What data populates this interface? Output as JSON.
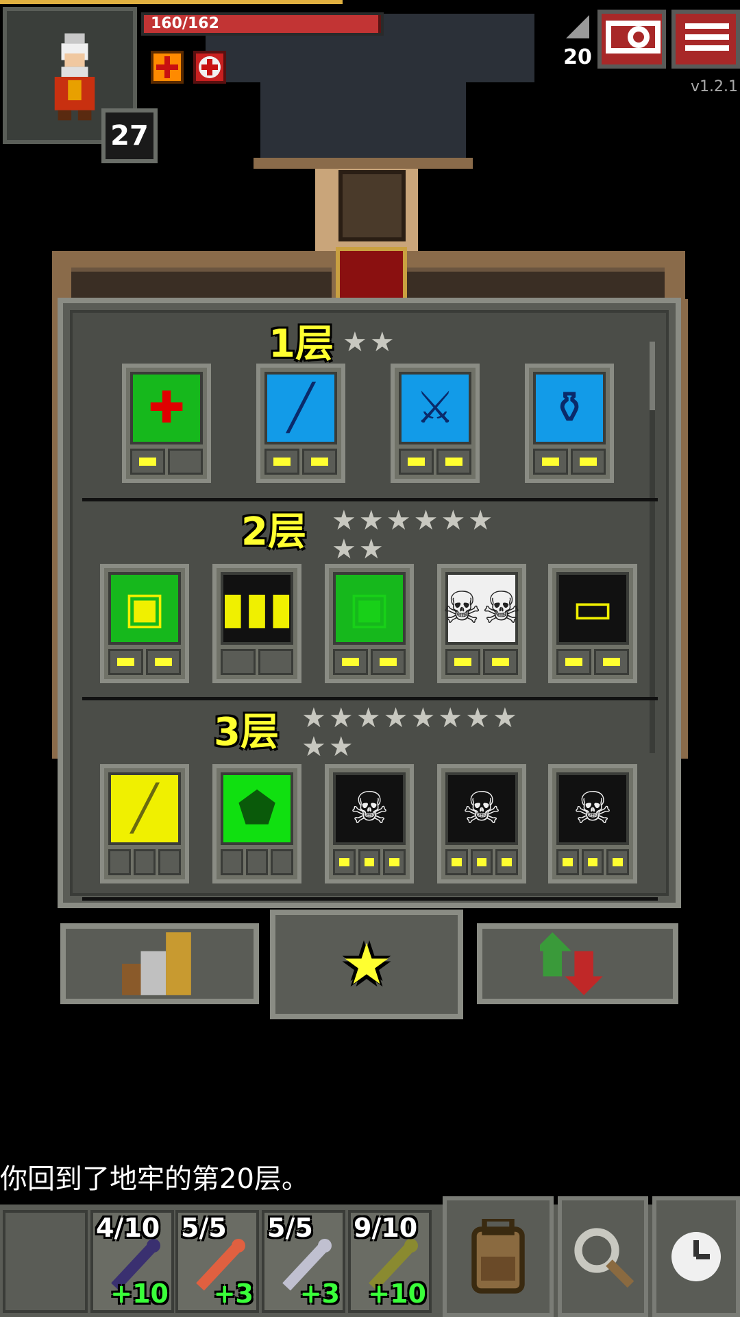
{
  "hud": {
    "hp_text": "160/162",
    "hp_fraction": 0.988,
    "level": "27",
    "depth": "20",
    "version": "v1.2.1",
    "buff_icons": [
      "healing-plus-icon",
      "medkit-icon"
    ]
  },
  "top_buttons": [
    {
      "name": "search-journal-icon"
    },
    {
      "name": "menu-icon"
    }
  ],
  "tiers": [
    {
      "title": "1层",
      "stars": "★★",
      "talents": [
        {
          "icon": "heal-on-eat-icon",
          "bg": "#16b81c",
          "glyph": "✚",
          "glyph_color": "#e00000",
          "pips_on": 1,
          "pips_total": 2
        },
        {
          "icon": "wand-identify-icon",
          "bg": "#129be8",
          "glyph": "╱",
          "glyph_color": "#0a2a6a",
          "pips_on": 2,
          "pips_total": 2
        },
        {
          "icon": "weapon-upgrade-icon",
          "bg": "#129be8",
          "glyph": "⚔",
          "glyph_color": "#0a2a6a",
          "pips_on": 2,
          "pips_total": 2
        },
        {
          "icon": "potion-identify-icon",
          "bg": "#129be8",
          "glyph": "⚱",
          "glyph_color": "#0a2a6a",
          "pips_on": 2,
          "pips_total": 2
        }
      ]
    },
    {
      "title": "2层",
      "stars": "★★★★★★\n★★",
      "talents": [
        {
          "icon": "energizing-meal-icon",
          "bg": "#16b81c",
          "glyph": "▣",
          "glyph_color": "#f0f000",
          "pips_on": 2,
          "pips_total": 2
        },
        {
          "icon": "battery-charge-icon",
          "bg": "#111111",
          "glyph": "▮▮▮",
          "glyph_color": "#f0f000",
          "pips_on": 0,
          "pips_total": 2
        },
        {
          "icon": "meal-recharge-icon",
          "bg": "#16b81c",
          "glyph": "▣",
          "glyph_color": "#18d018",
          "pips_on": 2,
          "pips_total": 2
        },
        {
          "icon": "skull-pair-icon",
          "bg": "#f0f0f0",
          "glyph": "☠☠",
          "glyph_color": "#222",
          "pips_on": 2,
          "pips_total": 2
        },
        {
          "icon": "empty-battery-icon",
          "bg": "#111111",
          "glyph": "▭",
          "glyph_color": "#f0f000",
          "pips_on": 2,
          "pips_total": 2
        }
      ]
    },
    {
      "title": "3层",
      "stars": "★★★★★★★★\n★★",
      "talents": [
        {
          "icon": "staff-upgrade-icon",
          "bg": "#f0f000",
          "glyph": "╱",
          "glyph_color": "#6a6a10",
          "pips_on": 0,
          "pips_total": 3
        },
        {
          "icon": "shield-upgrade-icon",
          "bg": "#10e010",
          "glyph": "⬟",
          "glyph_color": "#0a5a0a",
          "pips_on": 0,
          "pips_total": 3
        },
        {
          "icon": "skull-cross-icon",
          "bg": "#111111",
          "glyph": "☠",
          "glyph_color": "#f0f0f0",
          "pips_on": 3,
          "pips_total": 3
        },
        {
          "icon": "skull-arrow-icon",
          "bg": "#111111",
          "glyph": "☠",
          "glyph_color": "#f0f0f0",
          "pips_on": 3,
          "pips_total": 3
        },
        {
          "icon": "skull-heart-icon",
          "bg": "#111111",
          "glyph": "☠",
          "glyph_color": "#f0f0f0",
          "pips_on": 3,
          "pips_total": 3
        }
      ]
    }
  ],
  "tabs": [
    {
      "name": "tab-stats",
      "icon": "stats-bars-icon",
      "glyph": "▮▮▮",
      "color": "#c8b070"
    },
    {
      "name": "tab-talents",
      "icon": "star-icon",
      "glyph": "★",
      "color": "#ffff30"
    },
    {
      "name": "tab-subclass",
      "icon": "arrows-swap-icon",
      "glyph": "⇅",
      "color": "#c03030"
    }
  ],
  "log": {
    "message": "你回到了地牢的第20层。"
  },
  "quickslots": [
    {
      "count": "4/10",
      "bonus": "+10",
      "item": "dark-staff-icon",
      "color": "#3a3070"
    },
    {
      "count": "5/5",
      "bonus": "+3",
      "item": "fire-wand-icon",
      "color": "#e06040"
    },
    {
      "count": "5/5",
      "bonus": "+3",
      "item": "frost-wand-icon",
      "color": "#c0c0d0"
    },
    {
      "count": "9/10",
      "bonus": "+10",
      "item": "staff-icon",
      "color": "#8a8a30"
    }
  ],
  "toolbar_buttons": [
    {
      "name": "backpack-icon",
      "glyph": "🎒"
    },
    {
      "name": "magnifier-icon",
      "glyph": "🔍"
    },
    {
      "name": "wait-clock-icon",
      "glyph": "🕒"
    }
  ]
}
